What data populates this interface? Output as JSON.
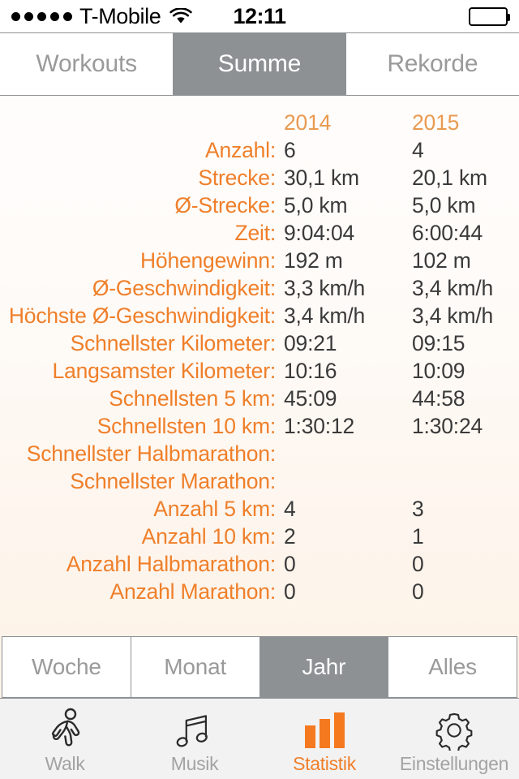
{
  "status_bar": {
    "signal_dots": 5,
    "carrier": "T-Mobile",
    "wifi_icon": "wifi-icon",
    "time": "12:11",
    "battery_icon": "battery-full-icon"
  },
  "top_tabs": {
    "items": [
      {
        "label": "Workouts",
        "active": false
      },
      {
        "label": "Summe",
        "active": true
      },
      {
        "label": "Rekorde",
        "active": false
      }
    ]
  },
  "table": {
    "columns": [
      "2014",
      "2015"
    ],
    "rows": [
      {
        "label": "Anzahl:",
        "values": [
          "6",
          "4"
        ]
      },
      {
        "label": "Strecke:",
        "values": [
          "30,1 km",
          "20,1 km"
        ]
      },
      {
        "label": "Ø-Strecke:",
        "values": [
          "5,0 km",
          "5,0 km"
        ]
      },
      {
        "label": "Zeit:",
        "values": [
          "9:04:04",
          "6:00:44"
        ]
      },
      {
        "label": "Höhengewinn:",
        "values": [
          "192 m",
          "102 m"
        ]
      },
      {
        "label": "Ø-Geschwindigkeit:",
        "values": [
          "3,3 km/h",
          "3,4 km/h"
        ]
      },
      {
        "label": "Höchste Ø-Geschwindigkeit:",
        "values": [
          "3,4 km/h",
          "3,4 km/h"
        ]
      },
      {
        "label": "Schnellster Kilometer:",
        "values": [
          "09:21",
          "09:15"
        ]
      },
      {
        "label": "Langsamster Kilometer:",
        "values": [
          "10:16",
          "10:09"
        ]
      },
      {
        "label": "Schnellsten 5 km:",
        "values": [
          "45:09",
          "44:58"
        ]
      },
      {
        "label": "Schnellsten 10 km:",
        "values": [
          "1:30:12",
          "1:30:24"
        ]
      },
      {
        "label": "Schnellster Halbmarathon:",
        "values": [
          "",
          ""
        ]
      },
      {
        "label": "Schnellster Marathon:",
        "values": [
          "",
          ""
        ]
      },
      {
        "label": "Anzahl 5 km:",
        "values": [
          "4",
          "3"
        ]
      },
      {
        "label": "Anzahl 10 km:",
        "values": [
          "2",
          "1"
        ]
      },
      {
        "label": "Anzahl Halbmarathon:",
        "values": [
          "0",
          "0"
        ]
      },
      {
        "label": "Anzahl Marathon:",
        "values": [
          "0",
          "0"
        ]
      }
    ]
  },
  "period_tabs": {
    "items": [
      {
        "label": "Woche",
        "active": false
      },
      {
        "label": "Monat",
        "active": false
      },
      {
        "label": "Jahr",
        "active": true
      },
      {
        "label": "Alles",
        "active": false
      }
    ]
  },
  "tab_bar": {
    "items": [
      {
        "label": "Walk",
        "icon": "walking-person-icon",
        "active": false
      },
      {
        "label": "Musik",
        "icon": "music-note-icon",
        "active": false
      },
      {
        "label": "Statistik",
        "icon": "bar-chart-icon",
        "active": true
      },
      {
        "label": "Einstellungen",
        "icon": "gear-icon",
        "active": false
      }
    ]
  },
  "colors": {
    "accent_orange": "#ef7f2a",
    "header_orange": "#e99a50",
    "segment_active": "#8e9194",
    "value_text": "#3a3a3a",
    "inactive_text": "#9a9a9a"
  }
}
